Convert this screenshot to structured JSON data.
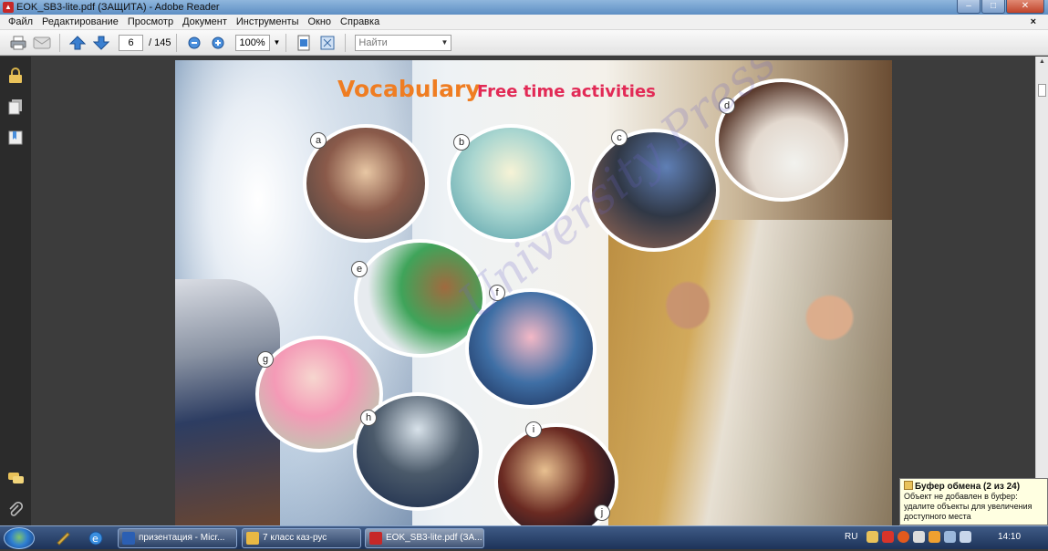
{
  "window": {
    "title": "EOK_SB3-lite.pdf (ЗАЩИТА) - Adobe Reader",
    "app_icon": "adobe-reader-icon",
    "buttons": [
      "minimize",
      "maximize",
      "close"
    ]
  },
  "menu": {
    "items": [
      "Файл",
      "Редактирование",
      "Просмотр",
      "Документ",
      "Инструменты",
      "Окно",
      "Справка"
    ],
    "close_glyph": "×"
  },
  "toolbar": {
    "page_current": "6",
    "page_total": "/ 145",
    "zoom": "100%",
    "find_placeholder": "Найти",
    "icons": [
      "print-icon",
      "email-icon",
      "page-up-icon",
      "page-down-icon",
      "zoom-out-icon",
      "zoom-in-icon",
      "fit-page-icon",
      "fullscreen-icon"
    ]
  },
  "sidebar": {
    "icons": [
      "lock-icon",
      "pages-icon",
      "bookmarks-icon",
      "comments-icon",
      "attachments-icon"
    ]
  },
  "document": {
    "title": "Vocabulary",
    "subtitle": "Free time activities",
    "watermark": "University Press",
    "labels": [
      "a",
      "b",
      "c",
      "d",
      "e",
      "f",
      "g",
      "h",
      "i",
      "j"
    ],
    "colors": {
      "title": "#ef7d22",
      "subtitle": "#e22a56"
    }
  },
  "notification": {
    "title": "Буфер обмена (2 из 24)",
    "body": "Объект не добавлен в буфер: удалите объекты для увеличения доступного места"
  },
  "taskbar": {
    "tasks": [
      {
        "label": "призентация - Micr...",
        "color": "#2b5fb3"
      },
      {
        "label": "7 класс каз-рус",
        "color": "#e8b844"
      },
      {
        "label": "EOK_SB3-lite.pdf (ЗА...",
        "color": "#c62828"
      }
    ],
    "language": "RU",
    "clock": "14:10"
  }
}
